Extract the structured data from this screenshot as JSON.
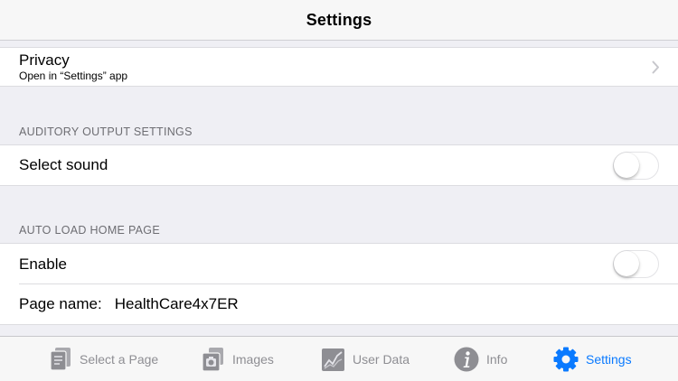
{
  "navbar": {
    "title": "Settings"
  },
  "privacy": {
    "title": "Privacy",
    "subtitle": "Open in “Settings” app"
  },
  "auditory": {
    "header": "AUDITORY OUTPUT SETTINGS",
    "select_sound_label": "Select sound",
    "select_sound_on": false
  },
  "autoload": {
    "header": "AUTO LOAD HOME PAGE",
    "enable_label": "Enable",
    "enable_on": false,
    "page_name_label": "Page name:",
    "page_name_value": "HealthCare4x7ER"
  },
  "tabbar": {
    "tabs": [
      {
        "label": "Select a Page",
        "icon": "pages-icon",
        "active": false
      },
      {
        "label": "Images",
        "icon": "images-icon",
        "active": false
      },
      {
        "label": "User Data",
        "icon": "chart-icon",
        "active": false
      },
      {
        "label": "Info",
        "icon": "info-icon",
        "active": false
      },
      {
        "label": "Settings",
        "icon": "gear-icon",
        "active": true
      }
    ]
  },
  "colors": {
    "accent": "#0a7aff",
    "inactive": "#8e8e93",
    "background": "#efeff4"
  }
}
